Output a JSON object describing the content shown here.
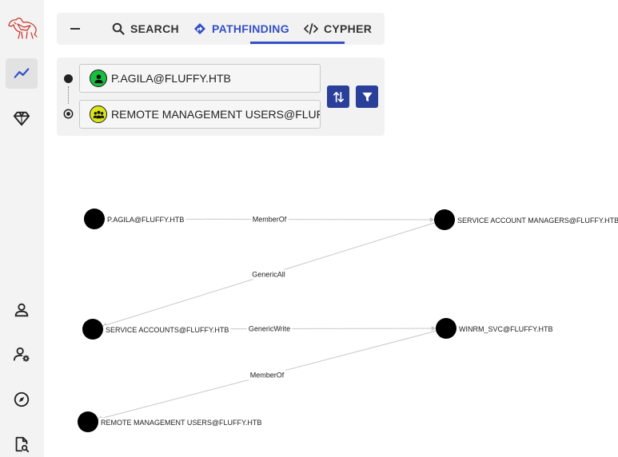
{
  "tabs": [
    {
      "label": "SEARCH",
      "icon": "search-icon"
    },
    {
      "label": "PATHFINDING",
      "icon": "route-icon"
    },
    {
      "label": "CYPHER",
      "icon": "code-icon"
    }
  ],
  "active_tab": "PATHFINDING",
  "pathfinding": {
    "source": "P.AGILA@FLUFFY.HTB",
    "source_type": "User",
    "target": "REMOTE MANAGEMENT USERS@FLUF",
    "target_type": "Group"
  },
  "sidebar": {
    "items": [
      {
        "name": "explore",
        "icon": "line-chart-icon",
        "active": true
      },
      {
        "name": "gem",
        "icon": "gem-icon",
        "active": false
      },
      {
        "name": "user",
        "icon": "user-icon",
        "active": false
      },
      {
        "name": "user-settings",
        "icon": "user-gear-icon",
        "active": false
      },
      {
        "name": "compass",
        "icon": "compass-icon",
        "active": false
      },
      {
        "name": "file-search",
        "icon": "file-search-icon",
        "active": false
      }
    ]
  },
  "graph": {
    "nodes": [
      {
        "id": "agila",
        "label": "P.AGILA@FLUFFY.HTB"
      },
      {
        "id": "sam",
        "label": "SERVICE ACCOUNT MANAGERS@FLUFFY.HTB"
      },
      {
        "id": "sa",
        "label": "SERVICE ACCOUNTS@FLUFFY.HTB"
      },
      {
        "id": "winrm",
        "label": "WINRM_SVC@FLUFFY.HTB"
      },
      {
        "id": "rmu",
        "label": "REMOTE MANAGEMENT USERS@FLUFFY.HTB"
      }
    ],
    "edges": [
      {
        "from": "agila",
        "to": "sam",
        "label": "MemberOf"
      },
      {
        "from": "sam",
        "to": "sa",
        "label": "GenericAll"
      },
      {
        "from": "sa",
        "to": "winrm",
        "label": "GenericWrite"
      },
      {
        "from": "winrm",
        "to": "rmu",
        "label": "MemberOf"
      }
    ]
  },
  "colors": {
    "accent": "#3350c6",
    "button": "#2a3f99",
    "user_icon_bg": "#17bf3f",
    "group_icon_bg": "#dbe617",
    "logo": "#c9302c"
  }
}
